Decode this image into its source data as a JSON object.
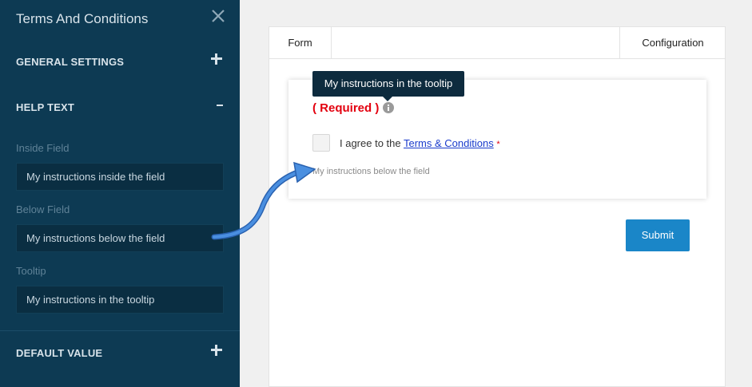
{
  "sidebar": {
    "title": "Terms And Conditions",
    "sections": {
      "general_settings": "GENERAL SETTINGS",
      "help_text": "HELP TEXT",
      "default_value": "DEFAULT VALUE"
    },
    "fields": {
      "inside_label": "Inside Field",
      "inside_value": "My instructions inside the field",
      "below_label": "Below Field",
      "below_value": "My instructions below the field",
      "tooltip_label": "Tooltip",
      "tooltip_value": "My instructions in the tooltip"
    }
  },
  "tabs": {
    "form": "Form",
    "configuration": "Configuration"
  },
  "form": {
    "tooltip": "My instructions in the tooltip",
    "required": "( Required )",
    "agree_prefix": "I agree to the ",
    "agree_link": "Terms & Conditions",
    "asterisk": "*",
    "below_text": "My instructions below the field",
    "submit_label": "Submit"
  },
  "colors": {
    "sidebar_bg": "#0d3a53",
    "accent": "#1a86c8",
    "required": "#e3000f",
    "annotation_arrow": "#3d7fd6"
  },
  "icons": {
    "close": "close-icon",
    "expand": "plus-icon",
    "collapse": "minus-icon",
    "info": "info-icon"
  }
}
